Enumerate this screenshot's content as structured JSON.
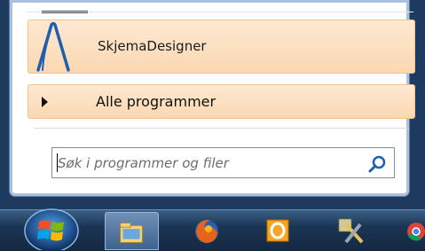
{
  "start_menu": {
    "pinned_item": {
      "label": "SkjemaDesigner",
      "icon": "skjemadesigner-a-icon"
    },
    "all_programs": {
      "label": "Alle programmer",
      "icon": "right-arrow-icon"
    },
    "search": {
      "placeholder": "Søk i programmer og filer",
      "value": "",
      "icon": "search-icon"
    }
  },
  "taskbar": {
    "start_button": {
      "icon": "windows-orb-icon"
    },
    "items": [
      {
        "name": "windows-explorer",
        "icon": "folder-icon"
      },
      {
        "name": "firefox",
        "icon": "firefox-icon"
      },
      {
        "name": "outlook",
        "icon": "outlook-icon"
      },
      {
        "name": "tool",
        "icon": "tools-icon"
      },
      {
        "name": "chrome",
        "icon": "chrome-icon"
      }
    ]
  },
  "colors": {
    "highlight_top": "#fde9d2",
    "highlight_bottom": "#fbd8b1",
    "highlight_border": "#f3c08e",
    "app_icon_blue": "#1f5fae",
    "taskbar": "#1c3554"
  }
}
